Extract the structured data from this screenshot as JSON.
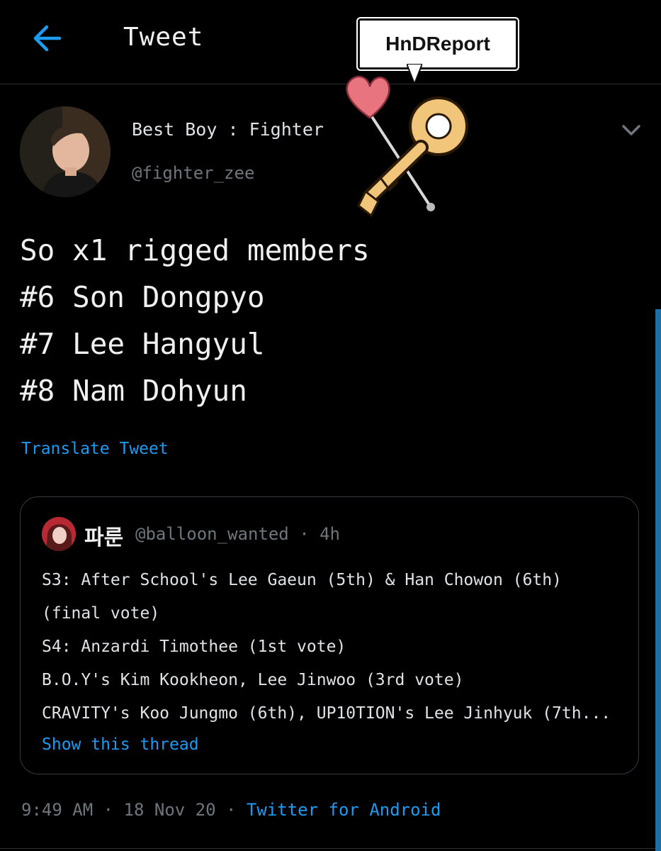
{
  "header": {
    "title": "Tweet",
    "back_icon": "arrow-left-icon",
    "accent_color": "#1d9bf0"
  },
  "watermark": {
    "text": "HnDReport"
  },
  "author": {
    "display_name": "Best Boy : Fighter",
    "handle": "@fighter_zee"
  },
  "tweet": {
    "lines": [
      "So x1 rigged members",
      "#6 Son Dongpyo",
      "#7 Lee Hangyul",
      "#8 Nam Dohyun"
    ],
    "translate_label": "Translate Tweet"
  },
  "quoted_tweet": {
    "display_name": "파룬",
    "handle": "@balloon_wanted",
    "separator": "·",
    "time": "4h",
    "lines": [
      "S3: After School's Lee Gaeun (5th) & Han Chowon (6th)",
      "(final vote)",
      "S4: Anzardi Timothee (1st vote)",
      "B.O.Y's Kim Kookheon, Lee Jinwoo (3rd vote)",
      "CRAVITY's Koo Jungmo (6th), UP10TION's Lee Jinhyuk (7th..."
    ],
    "show_thread_label": "Show this thread"
  },
  "meta": {
    "time": "9:49 AM",
    "separator": "·",
    "date": "18 Nov 20",
    "source": "Twitter for Android"
  }
}
